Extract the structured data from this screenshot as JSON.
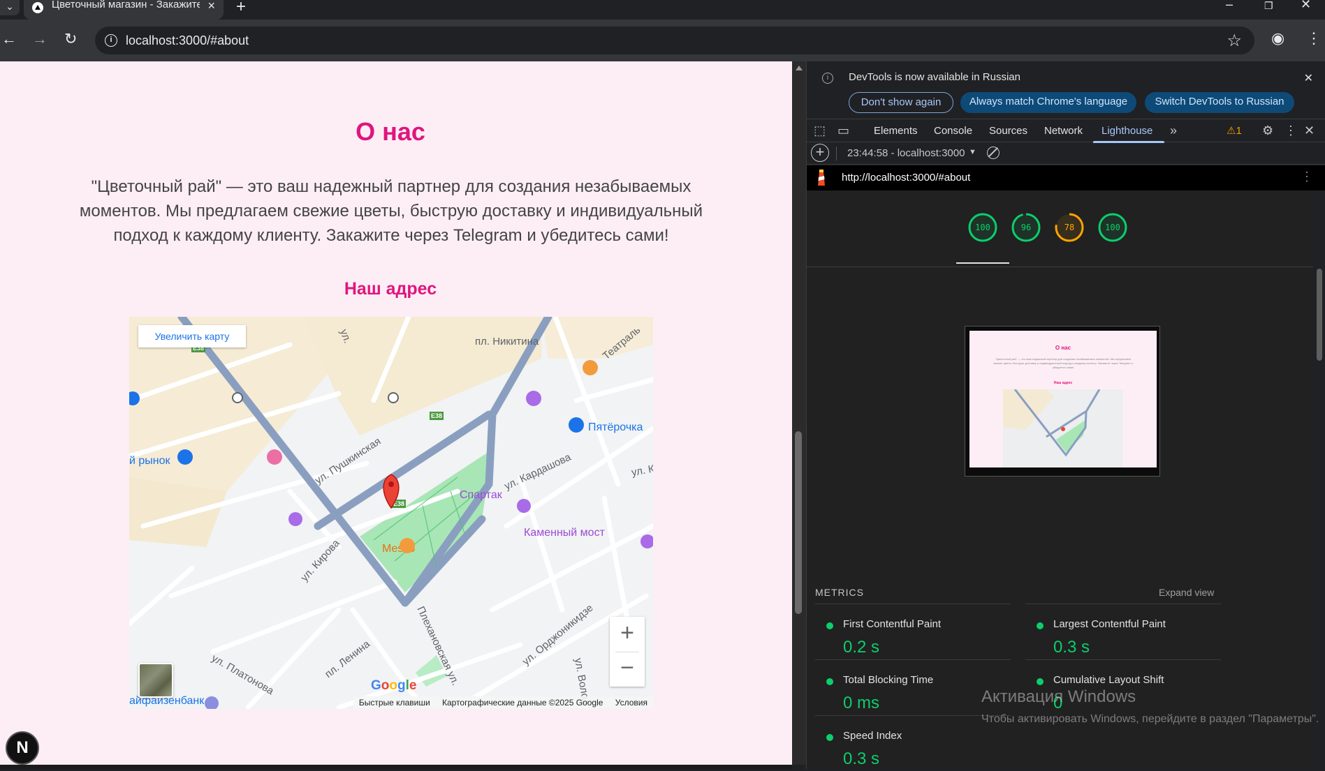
{
  "browser": {
    "tab_title": "Цветочный магазин - Закажите",
    "url": "localhost:3000/#about",
    "tab_menu_icon": "chevron-down-icon",
    "new_tab_icon": "plus-icon"
  },
  "page": {
    "title": "О нас",
    "about_text": "\"Цветочный рай\" — это ваш надежный партнер для создания незабываемых моментов. Мы предлагаем свежие цветы, быструю доставку и индивидуальный подход к каждому клиенту. Закажите через Telegram и убедитесь сами!",
    "address_title": "Наш адрес",
    "accent_color": "#e0157e",
    "background_color": "#fdeef5"
  },
  "map": {
    "enlarge_label": "Увеличить карту",
    "zoom_in": "+",
    "zoom_out": "−",
    "google_logo": "Google",
    "attribution": {
      "shortcuts": "Быстрые клавиши",
      "data": "Картографические данные ©2025 Google",
      "terms": "Условия"
    },
    "labels": {
      "nikitina": "пл. Никитина",
      "teatralnaya": "Театраль",
      "ul_short": "ул.",
      "pyaterochka": "Пятёрочка",
      "rynok": "й рынок",
      "pushkinskaya": "ул. Пушкинская",
      "kardashova": "ул. Кардашова",
      "ul_k": "ул. К",
      "spartak": "Спартак",
      "kamenny_most": "Каменный мост",
      "kirova": "ул. Кирова",
      "mesto": "MesTo",
      "ordzhonikidze": "ул. Орджоникидзе",
      "plekhanovskaya": "Плехановская ул.",
      "lenina": "пл. Ленина",
      "platonova": "ул. Платонова",
      "volod": "ул. Волод",
      "raiffeisen": "айфайзенбанк",
      "e38": "E38"
    }
  },
  "devtools": {
    "banner_message": "DevTools is now available in Russian",
    "btn_dont_show": "Don't show again",
    "btn_match_language": "Always match Chrome's language",
    "btn_switch_russian": "Switch DevTools to Russian",
    "tabs": [
      "Elements",
      "Console",
      "Sources",
      "Network",
      "Lighthouse"
    ],
    "active_tab": "Lighthouse",
    "warning_count": "1",
    "report_selector": "23:44:58 - localhost:3000",
    "report_url": "http://localhost:3000/#about",
    "scores": [
      {
        "value": 100,
        "label": "100",
        "color": "#0cce6b"
      },
      {
        "value": 96,
        "label": "96",
        "color": "#0cce6b"
      },
      {
        "value": 78,
        "label": "78",
        "color": "#ffa400"
      },
      {
        "value": 100,
        "label": "100",
        "color": "#0cce6b"
      }
    ],
    "thumbnail": {
      "title": "О нас",
      "text": "\"Цветочный рай\" — это ваш надежный партнер для создания незабываемых моментов. Мы предлагаем свежие цветы, быструю доставку и индивидуальный подход к каждому клиенту. Закажите через Telegram и убедитесь сами!",
      "subtitle": "Наш адрес"
    },
    "metrics_title": "METRICS",
    "expand_view": "Expand view",
    "metrics": [
      {
        "name": "First Contentful Paint",
        "value": "0.2 s"
      },
      {
        "name": "Largest Contentful Paint",
        "value": "0.3 s"
      },
      {
        "name": "Total Blocking Time",
        "value": "0 ms"
      },
      {
        "name": "Cumulative Layout Shift",
        "value": "0"
      },
      {
        "name": "Speed Index",
        "value": "0.3 s"
      }
    ]
  },
  "watermark": {
    "title": "Активация Windows",
    "subtitle": "Чтобы активировать Windows, перейдите в раздел \"Параметры\"."
  },
  "next_badge": "N"
}
